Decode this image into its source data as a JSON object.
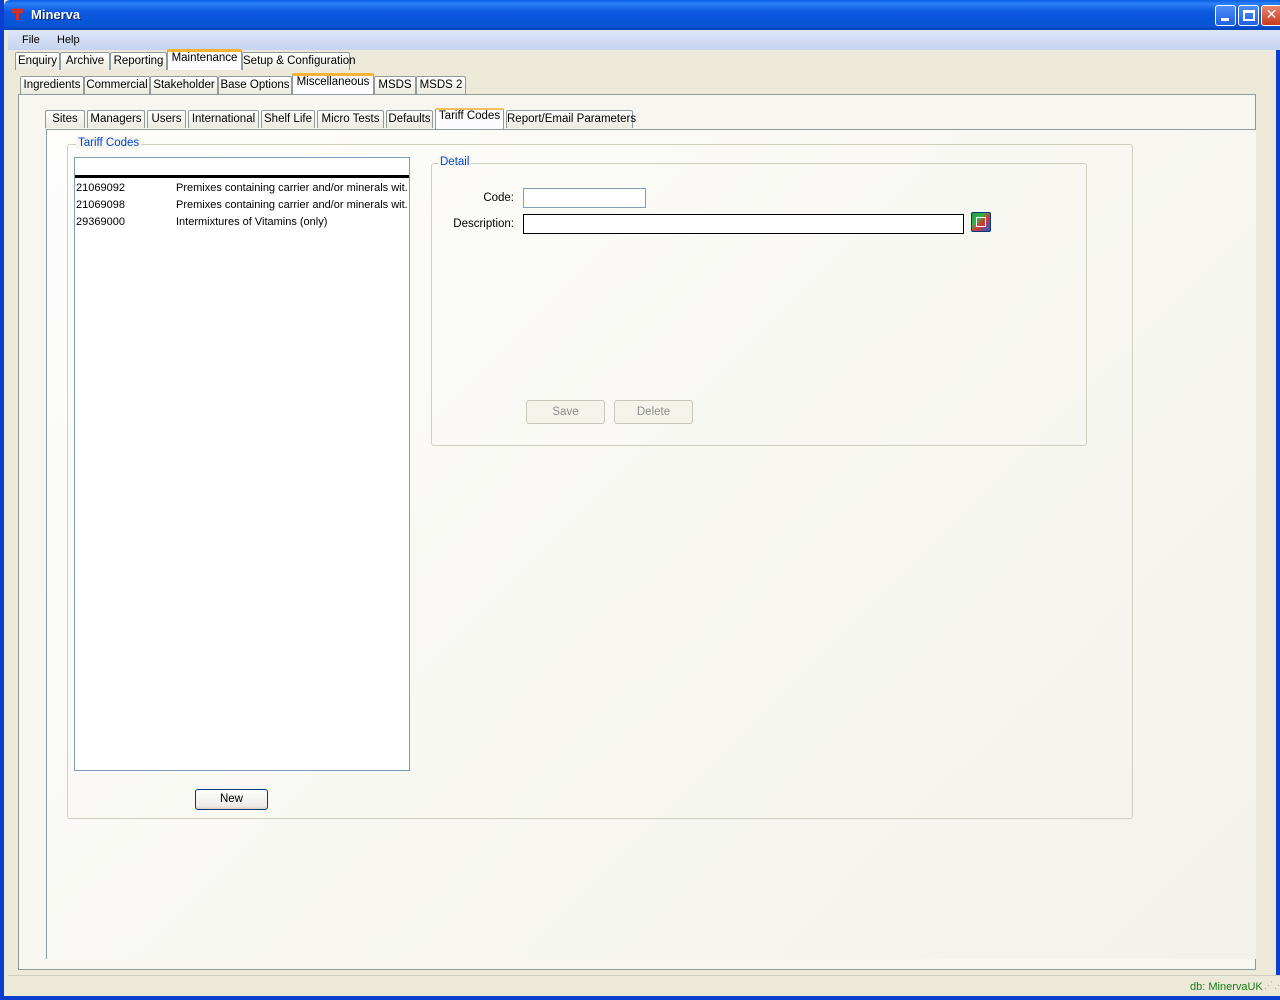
{
  "window": {
    "title": "Minerva",
    "minimize_label": "",
    "maximize_label": "",
    "close_label": "✕"
  },
  "menu": {
    "items": [
      "File",
      "Help"
    ]
  },
  "main_tabs": [
    "Enquiry",
    "Archive",
    "Reporting",
    "Maintenance",
    "Setup & Configuration"
  ],
  "sub_tabs": [
    "Ingredients",
    "Commercial",
    "Stakeholder",
    "Base Options",
    "Miscellaneous",
    "MSDS",
    "MSDS 2"
  ],
  "misc_tabs": [
    "Sites",
    "Managers",
    "Users",
    "International",
    "Shelf Life",
    "Micro Tests",
    "Defaults",
    "Tariff Codes",
    "Report/Email Parameters"
  ],
  "tariff_codes": {
    "group_title": "Tariff Codes",
    "rows": [
      {
        "code": "21069092",
        "description": "Premixes containing carrier and/or minerals wit..."
      },
      {
        "code": "21069098",
        "description": "Premixes containing carrier and/or minerals wit..."
      },
      {
        "code": "29369000",
        "description": "Intermixtures of Vitamins (only)"
      }
    ],
    "new_label": "New"
  },
  "detail": {
    "group_title": "Detail",
    "code_label": "Code:",
    "code_value": "",
    "description_label": "Description:",
    "description_value": "",
    "save_label": "Save",
    "delete_label": "Delete"
  },
  "status": {
    "db_text": "db: MinervaUK"
  }
}
